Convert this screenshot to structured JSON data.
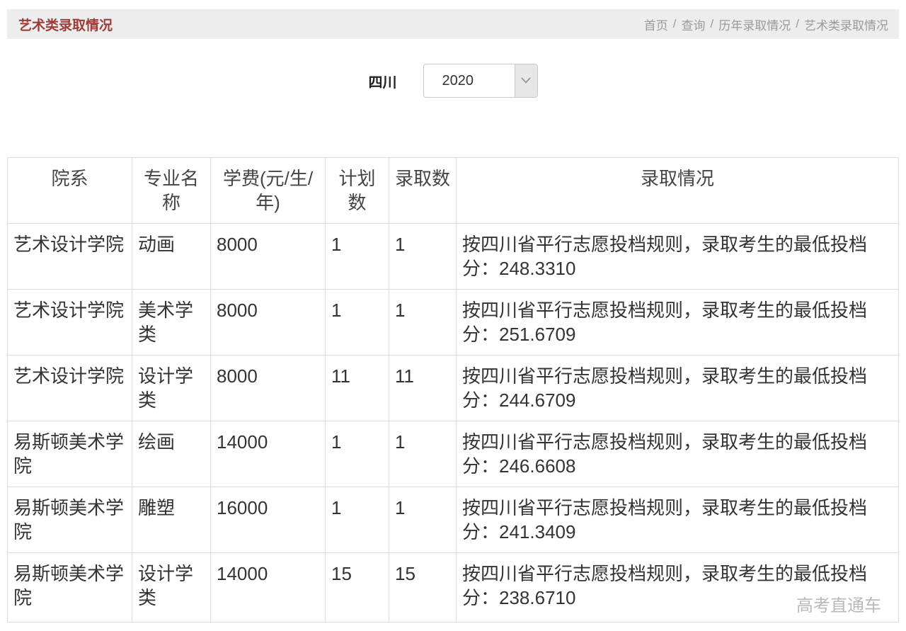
{
  "page": {
    "title": "艺术类录取情况",
    "breadcrumb": {
      "separator": "/",
      "items": [
        "首页",
        "查询",
        "历年录取情况",
        "艺术类录取情况"
      ]
    }
  },
  "filter": {
    "province_label": "四川",
    "year_select": {
      "value": "2020",
      "icon": "chevron-down"
    }
  },
  "table": {
    "columns": [
      "院系",
      "专业名称",
      "学费(元/生/年)",
      "计划数",
      "录取数",
      "录取情况"
    ],
    "rows": [
      [
        "艺术设计学院",
        "动画",
        "8000",
        "1",
        "1",
        "按四川省平行志愿投档规则，录取考生的最低投档分：248.3310"
      ],
      [
        "艺术设计学院",
        "美术学类",
        "8000",
        "1",
        "1",
        "按四川省平行志愿投档规则，录取考生的最低投档分：251.6709"
      ],
      [
        "艺术设计学院",
        "设计学类",
        "8000",
        "11",
        "11",
        "按四川省平行志愿投档规则，录取考生的最低投档分：244.6709"
      ],
      [
        "易斯顿美术学院",
        "绘画",
        "14000",
        "1",
        "1",
        "按四川省平行志愿投档规则，录取考生的最低投档分：246.6608"
      ],
      [
        "易斯顿美术学院",
        "雕塑",
        "16000",
        "1",
        "1",
        "按四川省平行志愿投档规则，录取考生的最低投档分：241.3409"
      ],
      [
        "易斯顿美术学院",
        "设计学类",
        "14000",
        "15",
        "15",
        "按四川省平行志愿投档规则，录取考生的最低投档分：238.6710"
      ]
    ]
  },
  "watermark": "高考直通车",
  "colors": {
    "title": "#9c3c3a",
    "topbar_bg": "#ededed",
    "breadcrumb_text": "#9a9a9a",
    "table_border": "#dcdcdc",
    "body_text": "#333333",
    "watermark_text": "#b9b9b9"
  }
}
